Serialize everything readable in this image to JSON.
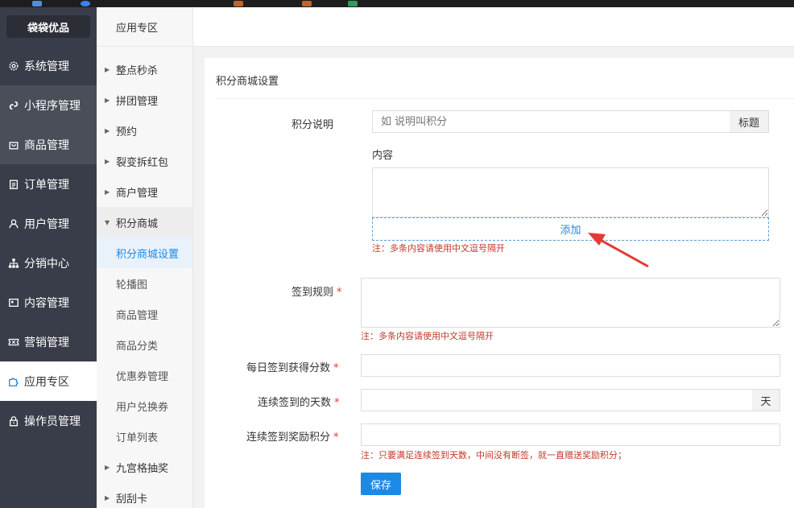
{
  "brand": "袋袋优品",
  "colors": {
    "sidebar": "#393d49",
    "accent": "#1e88e5",
    "hint": "#c0392b",
    "annotation_arrow": "#e53935"
  },
  "nav": [
    {
      "label": "系统管理",
      "icon": "gear-icon"
    },
    {
      "label": "小程序管理",
      "icon": "link-icon"
    },
    {
      "label": "商品管理",
      "icon": "bag-icon"
    },
    {
      "label": "订单管理",
      "icon": "clipboard-icon"
    },
    {
      "label": "用户管理",
      "icon": "user-icon"
    },
    {
      "label": "分销中心",
      "icon": "network-icon"
    },
    {
      "label": "内容管理",
      "icon": "document-icon"
    },
    {
      "label": "营销管理",
      "icon": "ticket-icon"
    },
    {
      "label": "应用专区",
      "icon": "puzzle-icon"
    },
    {
      "label": "操作员管理",
      "icon": "lock-icon"
    }
  ],
  "sub_nav": {
    "header": "应用专区",
    "items": [
      {
        "label": "整点秒杀"
      },
      {
        "label": "拼团管理"
      },
      {
        "label": "预约"
      },
      {
        "label": "裂变拆红包"
      },
      {
        "label": "商户管理"
      },
      {
        "label": "积分商城"
      },
      {
        "label": "积分商城设置"
      },
      {
        "label": "轮播图"
      },
      {
        "label": "商品管理"
      },
      {
        "label": "商品分类"
      },
      {
        "label": "优惠券管理"
      },
      {
        "label": "用户兑换券"
      },
      {
        "label": "订单列表"
      },
      {
        "label": "九宫格抽奖"
      },
      {
        "label": "刮刮卡"
      }
    ]
  },
  "page": {
    "title": "积分商城设置",
    "points_desc": {
      "label": "积分说明",
      "title_placeholder": "如 说明叫积分",
      "title_addon": "标题",
      "content_label": "内容",
      "add_button": "添加",
      "hint": "注：多条内容请使用中文逗号隔开"
    },
    "checkin_rules": {
      "label": "签到规则",
      "required_mark": "*",
      "hint": "注：多条内容请使用中文逗号隔开"
    },
    "daily_points": {
      "label": "每日签到获得分数",
      "required_mark": "*"
    },
    "consecutive_days": {
      "label": "连续签到的天数",
      "required_mark": "*",
      "addon": "天"
    },
    "consecutive_reward": {
      "label": "连续签到奖励积分",
      "required_mark": "*",
      "hint": "注：只要满足连续签到天数，中间没有断签，就一直赠送奖励积分；"
    },
    "save_button": "保存"
  }
}
